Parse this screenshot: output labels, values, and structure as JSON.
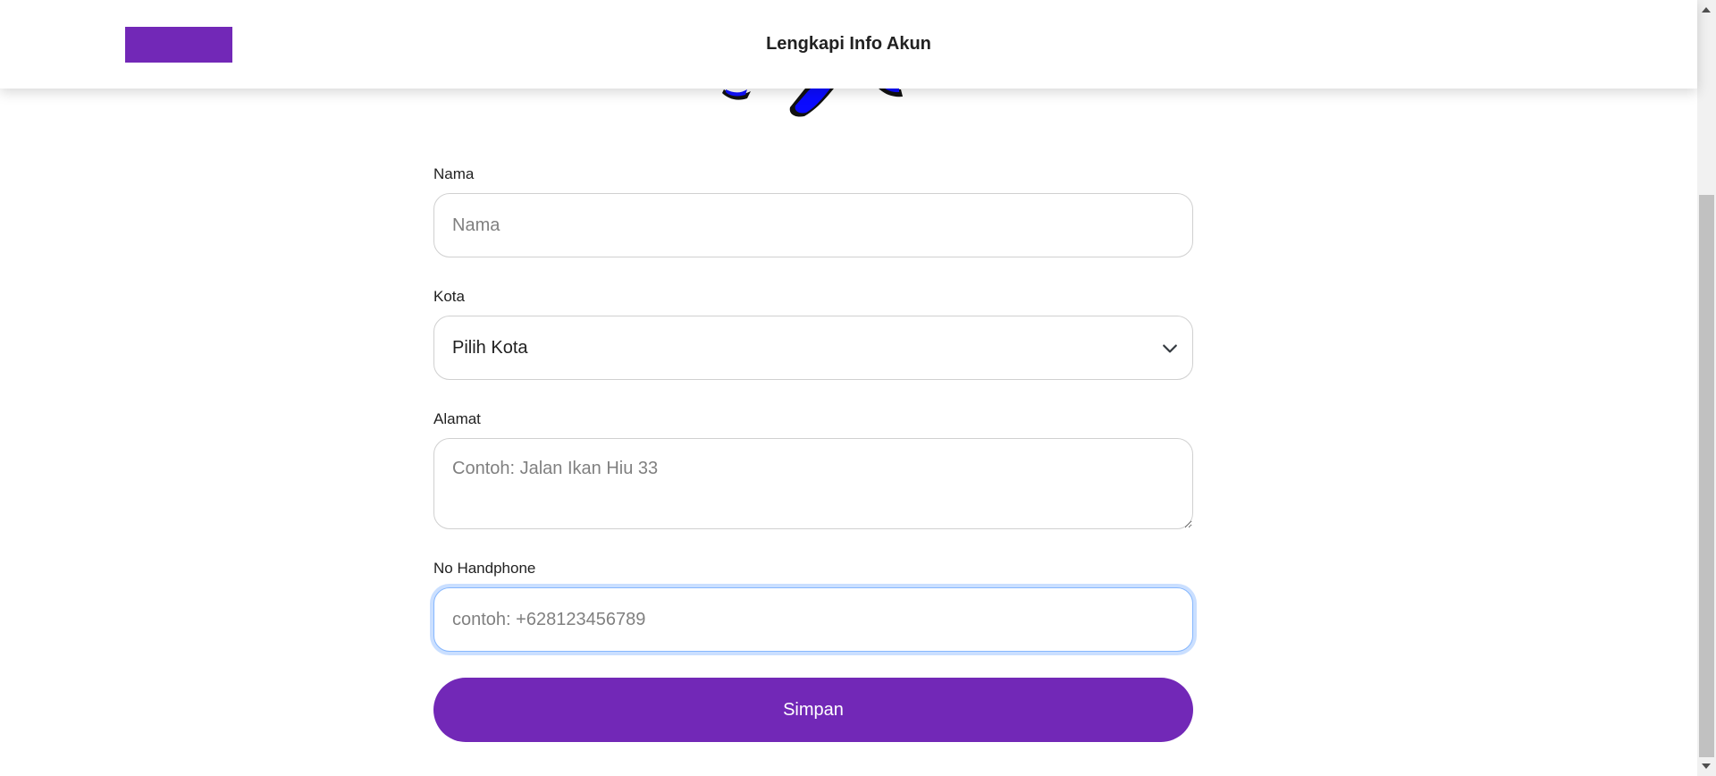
{
  "header": {
    "title": "Lengkapi Info Akun"
  },
  "form": {
    "name": {
      "label": "Nama",
      "placeholder": "Nama",
      "value": ""
    },
    "city": {
      "label": "Kota",
      "selected": "Pilih Kota"
    },
    "address": {
      "label": "Alamat",
      "placeholder": "Contoh: Jalan Ikan Hiu 33",
      "value": ""
    },
    "phone": {
      "label": "No Handphone",
      "placeholder": "contoh: +628123456789",
      "value": ""
    },
    "submit_label": "Simpan"
  },
  "colors": {
    "accent": "#7228b7",
    "focus_ring": "#86b7fe",
    "illustration_blue": "#0000ff"
  },
  "icons": {
    "select_chevron": "chevron-down-icon",
    "scroll_up": "scroll-up-arrow-icon",
    "scroll_down": "scroll-down-arrow-icon"
  }
}
